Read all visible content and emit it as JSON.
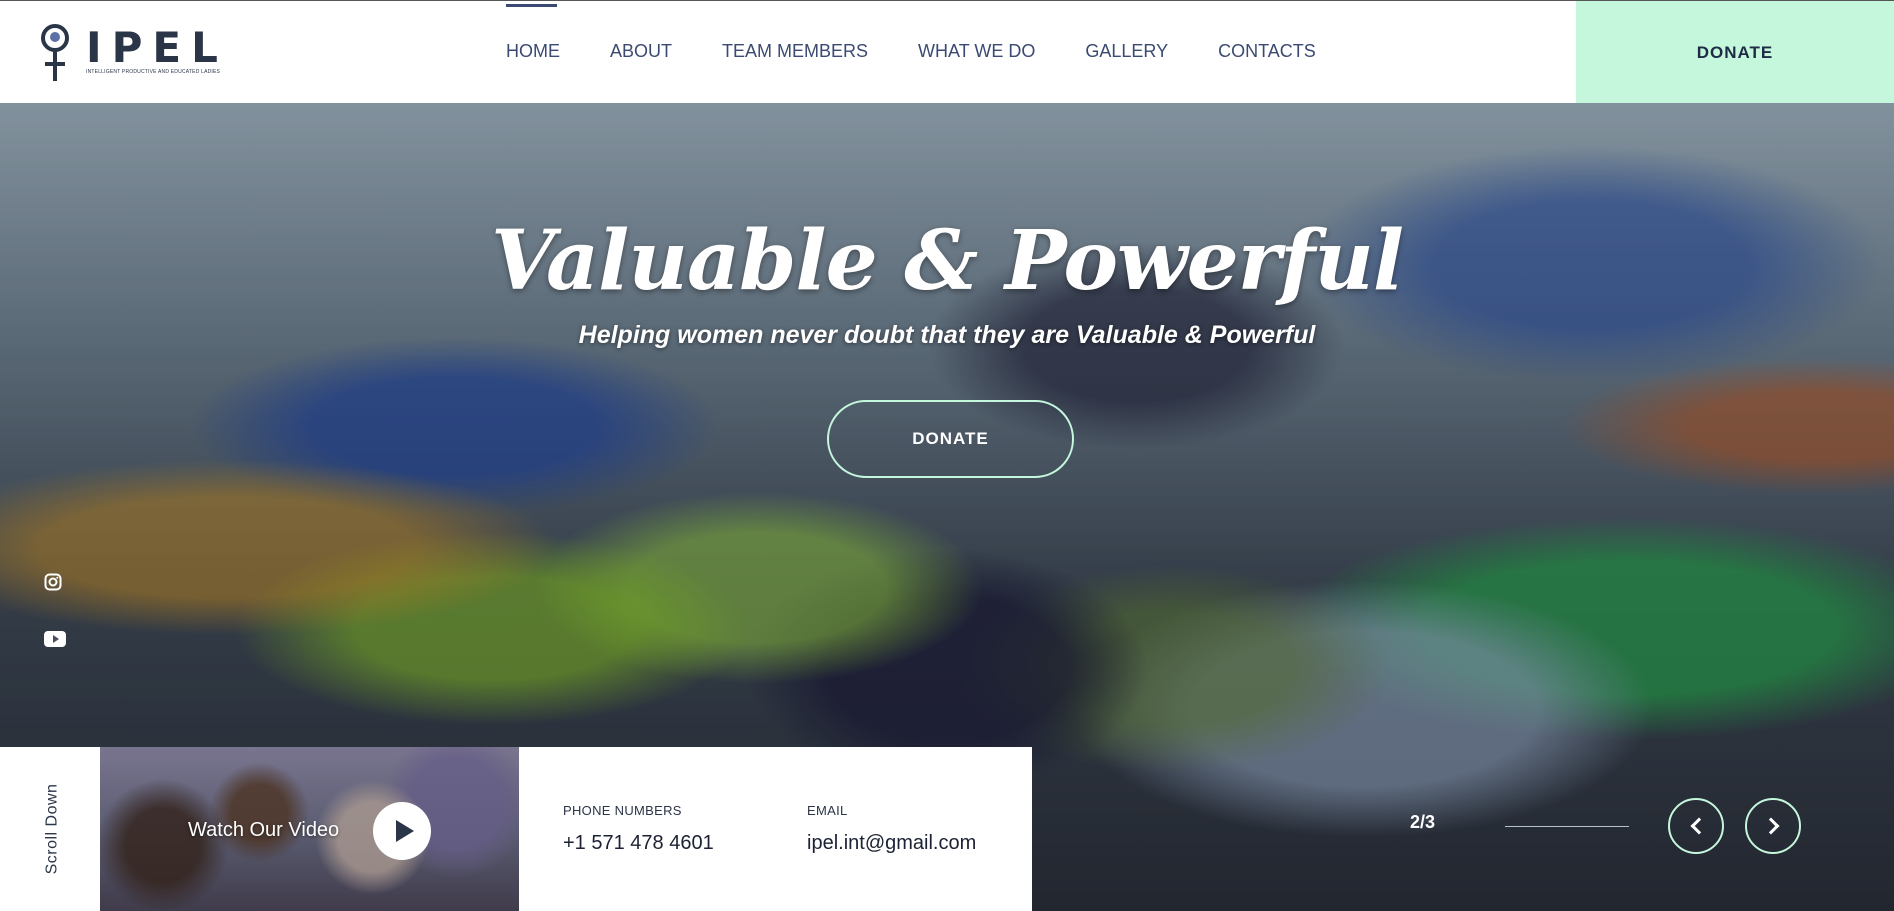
{
  "brand": {
    "name": "IPEL",
    "tagline": "INTELLIGENT PRODUCTIVE AND EDUCATED LADIES",
    "logo_icon": "female-symbol-icon"
  },
  "nav": {
    "items": [
      {
        "label": "HOME",
        "active": true
      },
      {
        "label": "ABOUT"
      },
      {
        "label": "TEAM MEMBERS"
      },
      {
        "label": "WHAT WE DO"
      },
      {
        "label": "GALLERY"
      },
      {
        "label": "CONTACTS"
      }
    ],
    "donate_label": "DONATE"
  },
  "hero": {
    "title": "Valuable & Powerful",
    "subtitle": "Helping women never doubt that they are Valuable & Powerful",
    "donate_label": "DONATE"
  },
  "social": {
    "instagram_icon": "instagram-icon",
    "youtube_icon": "youtube-icon"
  },
  "info_bar": {
    "scroll_label": "Scroll Down",
    "video_label": "Watch Our Video",
    "phone_label": "PHONE NUMBERS",
    "phone_value": "+1 571 478 4601",
    "email_label": "EMAIL",
    "email_value": "ipel.int@gmail.com"
  },
  "slider": {
    "counter": "2/3",
    "current": 2,
    "total": 3
  },
  "colors": {
    "accent": "#c5f7dc",
    "navy": "#2b3548",
    "nav_text": "#3b4a72"
  }
}
